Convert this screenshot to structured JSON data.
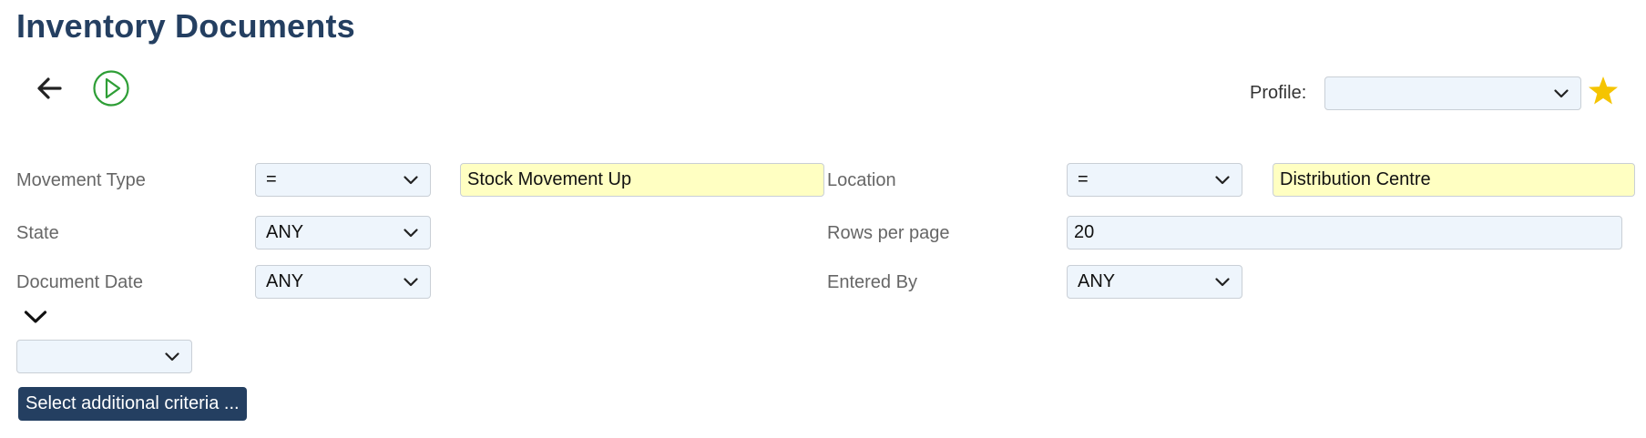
{
  "page": {
    "title": "Inventory Documents"
  },
  "toolbar": {
    "back_icon": "arrow-left-icon",
    "run_icon": "play-circle-icon",
    "run_color": "#2e9e36"
  },
  "profile": {
    "label": "Profile:",
    "value": "",
    "favorite_icon": "star-icon",
    "favorite_color": "#f5c400"
  },
  "criteria": {
    "movement_type": {
      "label": "Movement Type",
      "operator": "=",
      "value": "Stock Movement Up"
    },
    "location": {
      "label": "Location",
      "operator": "=",
      "value": "Distribution Centre"
    },
    "state": {
      "label": "State",
      "value": "ANY"
    },
    "rows_per_page": {
      "label": "Rows per page",
      "value": "20"
    },
    "document_date": {
      "label": "Document Date",
      "value": "ANY"
    },
    "entered_by": {
      "label": "Entered By",
      "value": "ANY"
    }
  },
  "additional": {
    "toggle_icon": "chevron-down-icon",
    "select_value": "",
    "button_label": "Select additional criteria ..."
  },
  "colors": {
    "accent": "#243f61",
    "highlight_input": "#ffffc2",
    "field_bg": "#eef5fc"
  }
}
